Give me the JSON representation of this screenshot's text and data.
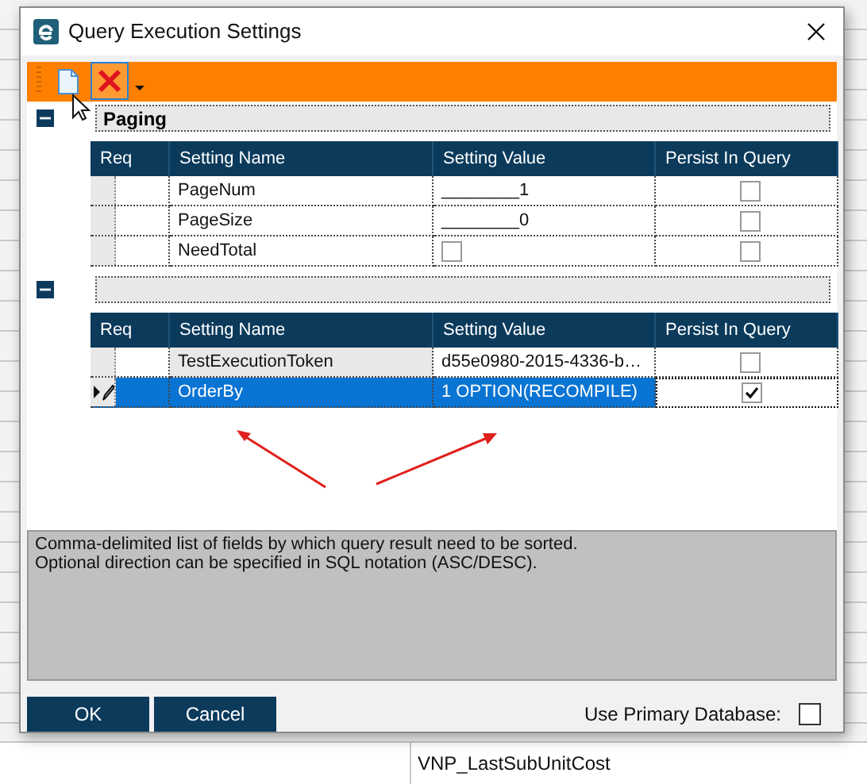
{
  "window": {
    "title": "Query Execution Settings"
  },
  "toolbar": [
    {
      "kind": "new",
      "hovered": false
    },
    {
      "kind": "delete",
      "hovered": true
    },
    {
      "kind": "dropdown",
      "hovered": false
    }
  ],
  "groups": [
    {
      "title": "Paging",
      "expanded": true,
      "columns": [
        "Req",
        "Setting Name",
        "Setting Value",
        "Persist In Query"
      ],
      "rows": [
        {
          "name": "PageNum",
          "kind": "text",
          "value": "________1",
          "persist": false,
          "selected": false
        },
        {
          "name": "PageSize",
          "kind": "text",
          "value": "________0",
          "persist": false,
          "selected": false
        },
        {
          "name": "NeedTotal",
          "kind": "checkbox",
          "value_checked": false,
          "persist": false,
          "selected": false
        }
      ]
    },
    {
      "expanded": true,
      "columns": [
        "Req",
        "Setting Name",
        "Setting Value",
        "Persist In Query"
      ],
      "rows": [
        {
          "name": "TestExecutionToken",
          "kind": "text",
          "value": "d55e0980-2015-4336-b…",
          "persist": false,
          "selected": false
        },
        {
          "name": "OrderBy",
          "kind": "text",
          "value": "1 OPTION(RECOMPILE)",
          "persist": true,
          "selected": true
        }
      ]
    }
  ],
  "description": [
    "Comma-delimited list of fields by which query result need to be sorted.",
    "Optional direction can be specified in SQL notation (ASC/DESC)."
  ],
  "buttons": [
    "OK",
    "Cancel"
  ],
  "primary_database": {
    "label": "Use Primary Database:",
    "checked": false
  },
  "background": {
    "cell": "VNP_LastSubUnitCost"
  }
}
